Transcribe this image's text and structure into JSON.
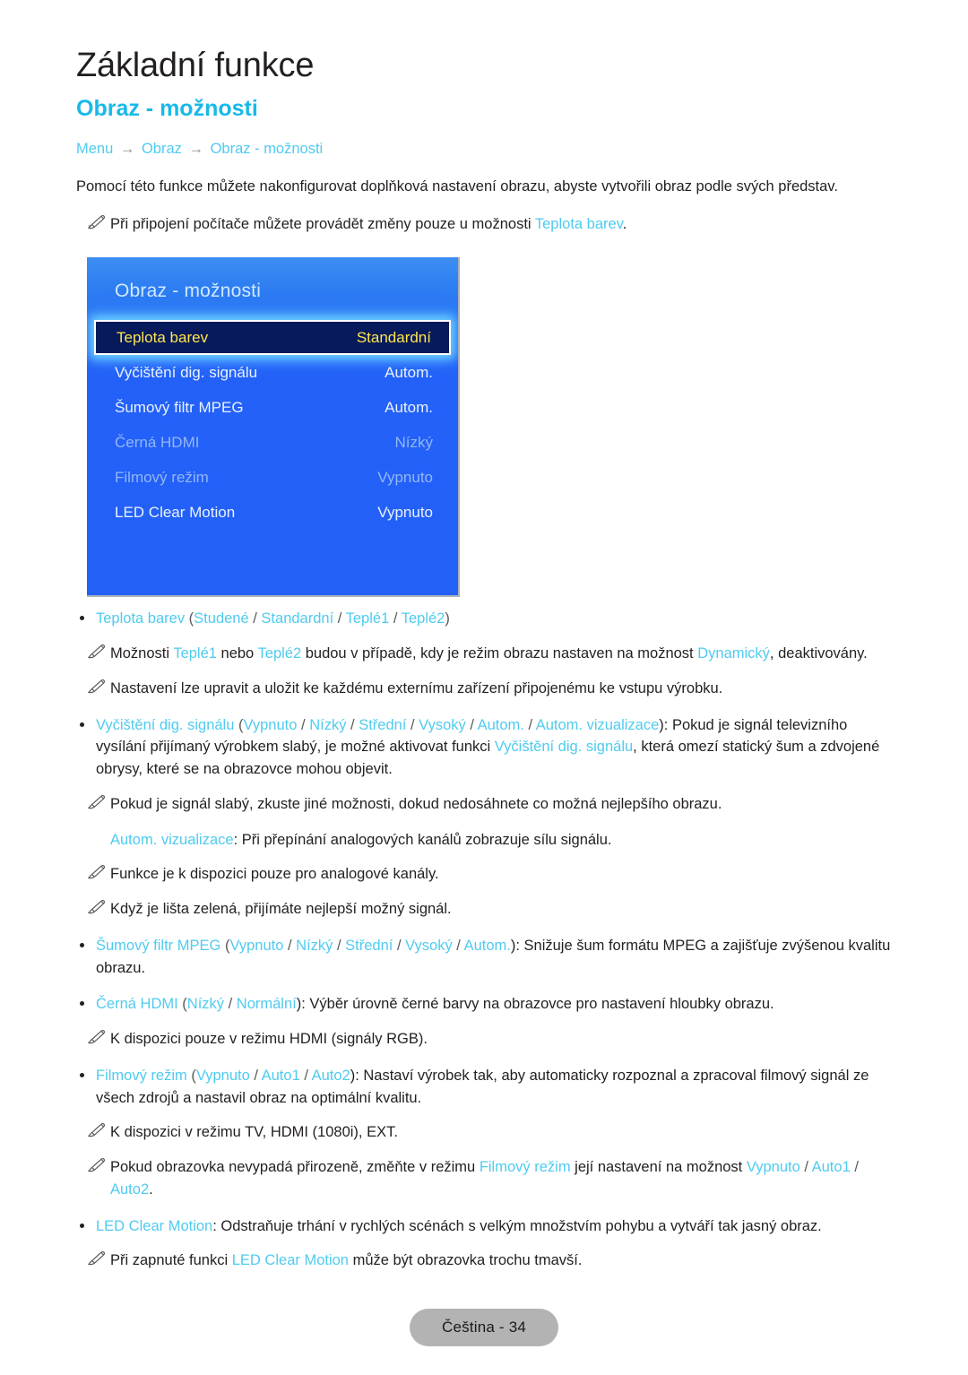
{
  "header": {
    "chapter_title": "Základní funkce",
    "section_title": "Obraz - možnosti",
    "breadcrumb": {
      "item1": "Menu",
      "arrow1": "→",
      "item2": "Obraz",
      "arrow2": "→",
      "item3": "Obraz - možnosti"
    },
    "intro": "Pomocí této funkce můžete nakonfigurovat doplňková nastavení obrazu, abyste vytvořili obraz podle svých představ.",
    "note1_pre": "Při připojení počítače můžete provádět změny pouze u možnosti ",
    "note1_link": "Teplota barev",
    "note1_post": "."
  },
  "osd": {
    "title": "Obraz - možnosti",
    "rows": [
      {
        "label": "Teplota barev",
        "value": "Standardní",
        "state": "selected"
      },
      {
        "label": "Vyčištění dig. signálu",
        "value": "Autom.",
        "state": "normal"
      },
      {
        "label": "Šumový filtr MPEG",
        "value": "Autom.",
        "state": "normal"
      },
      {
        "label": "Černá HDMI",
        "value": "Nízký",
        "state": "disabled"
      },
      {
        "label": "Filmový režim",
        "value": "Vypnuto",
        "state": "disabled"
      },
      {
        "label": "LED Clear Motion",
        "value": "Vypnuto",
        "state": "normal"
      }
    ]
  },
  "body": {
    "b1_name": "Teplota barev",
    "b1_open": " (",
    "b1_o1": "Studené",
    "b1_o2": "Standardní",
    "b1_o3": "Teplé1",
    "b1_o4": "Teplé2",
    "b1_close": ")",
    "n1_a": "Možnosti ",
    "n1_o1": "Teplé1",
    "n1_b": " nebo ",
    "n1_o2": "Teplé2",
    "n1_c": " budou v případě, kdy je režim obrazu nastaven na možnost ",
    "n1_o3": "Dynamický",
    "n1_d": ", deaktivovány.",
    "n2": "Nastavení lze upravit a uložit ke každému externímu zařízení připojenému ke vstupu výrobku.",
    "b2_name": "Vyčištění dig. signálu",
    "b2_open": " (",
    "b2_o1": "Vypnuto",
    "b2_o2": "Nízký",
    "b2_o3": "Střední",
    "b2_o4": "Vysoký",
    "b2_o5": "Autom.",
    "b2_o6": "Autom. vizualizace",
    "b2_close": "): Pokud je signál televizního vysílání přijímaný výrobkem slabý, je možné aktivovat funkci ",
    "b2_link2": "Vyčištění dig. signálu",
    "b2_tail": ", která omezí statický šum a zdvojené obrysy, které se na obrazovce mohou objevit.",
    "n3": "Pokud je signál slabý, zkuste jiné možnosti, dokud nedosáhnete co možná nejlepšího obrazu.",
    "p1_link": "Autom. vizualizace",
    "p1_text": ": Při přepínání analogových kanálů zobrazuje sílu signálu.",
    "n4": "Funkce je k dispozici pouze pro analogové kanály.",
    "n5": "Když je lišta zelená, přijímáte nejlepší možný signál.",
    "b3_name": "Šumový filtr MPEG",
    "b3_open": " (",
    "b3_o1": "Vypnuto",
    "b3_o2": "Nízký",
    "b3_o3": "Střední",
    "b3_o4": "Vysoký",
    "b3_o5": "Autom.",
    "b3_close": "): Snižuje šum formátu MPEG a zajišťuje zvýšenou kvalitu obrazu.",
    "b4_name": "Černá HDMI",
    "b4_open": " (",
    "b4_o1": "Nízký",
    "b4_o2": "Normální",
    "b4_close": "): Výběr úrovně černé barvy na obrazovce pro nastavení hloubky obrazu.",
    "n6": "K dispozici pouze v režimu HDMI (signály RGB).",
    "b5_name": "Filmový režim",
    "b5_open": " (",
    "b5_o1": "Vypnuto",
    "b5_o2": "Auto1",
    "b5_o3": "Auto2",
    "b5_close": "): Nastaví výrobek tak, aby automaticky rozpoznal a zpracoval filmový signál ze všech zdrojů a nastavil obraz na optimální kvalitu.",
    "n7": "K dispozici v režimu TV, HDMI (1080i), EXT.",
    "n8_a": "Pokud obrazovka nevypadá přirozeně, změňte v režimu ",
    "n8_link": "Filmový režim",
    "n8_b": " její nastavení na možnost ",
    "n8_o1": "Vypnuto",
    "n8_o2": "Auto1",
    "n8_o3": "Auto2",
    "n8_end": ".",
    "b6_name": "LED Clear Motion",
    "b6_text": ": Odstraňuje trhání v rychlých scénách s velkým množstvím pohybu a vytváří tak jasný obraz.",
    "n9_a": "Při zapnuté funkci ",
    "n9_link": "LED Clear Motion",
    "n9_b": " může být obrazovka trochu tmavší."
  },
  "footer": {
    "page_label": "Čeština - 34"
  },
  "colors": {
    "accent": "#18b9e8",
    "link": "#4fcbef",
    "osd_blue": "#2360f8",
    "osd_selected_bg": "#061a5c",
    "osd_selected_text": "#ffe64d"
  }
}
